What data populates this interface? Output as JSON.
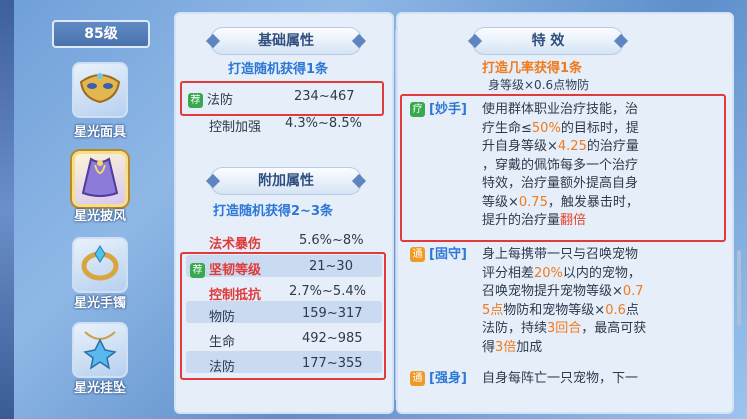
{
  "level": "85级",
  "items": [
    {
      "label": "星光面具",
      "icon": "mask-icon"
    },
    {
      "label": "星光披风",
      "icon": "cape-icon"
    },
    {
      "label": "星光手镯",
      "icon": "bracelet-icon"
    },
    {
      "label": "星光挂坠",
      "icon": "pendant-icon"
    }
  ],
  "basic": {
    "title": "基础属性",
    "subtitle": "打造随机获得1条",
    "rows": [
      {
        "tag": "荐",
        "name": "法防",
        "value": "234~467"
      },
      {
        "name": "控制加强",
        "value": "4.3%~8.5%"
      }
    ]
  },
  "extra": {
    "title": "附加属性",
    "subtitle": "打造随机获得2~3条",
    "rows": [
      {
        "name": "法术暴伤",
        "value": "5.6%~8%",
        "red": true
      },
      {
        "tag": "荐",
        "name": "坚韧等级",
        "value": "21~30",
        "red": true
      },
      {
        "name": "控制抵抗",
        "value": "2.7%~5.4%",
        "red": true
      },
      {
        "name": "物防",
        "value": "159~317"
      },
      {
        "name": "生命",
        "value": "492~985"
      },
      {
        "name": "法防",
        "value": "177~355"
      }
    ]
  },
  "effects": {
    "title": "特 效",
    "subtitle": "打造几率获得1条",
    "peek": "身等级×0.6点物防",
    "skills": [
      {
        "tag": "疗",
        "name": "[妙手]",
        "lines": [
          "使用群体职业治疗技能，治",
          "疗生命≤50%的目标时，提",
          "升自身等级×4.25的治疗量",
          "，穿戴的佩饰每多一个治疗",
          "特效，治疗量额外提高自身",
          "等级×0.75，触发暴击时，",
          "提升的治疗量翻倍"
        ]
      },
      {
        "tag": "通",
        "name": "[固守]",
        "lines": [
          "身上每携带一只与召唤宠物",
          "评分相差20%以内的宠物，",
          "召唤宠物提升宠物等级×0.7",
          "5点物防和宠物等级×0.6点",
          "法防，持续3回合，最高可获",
          "得3倍加成"
        ]
      },
      {
        "tag": "通",
        "name": "[强身]",
        "lines": [
          "自身每阵亡一只宠物，下一"
        ]
      }
    ]
  }
}
